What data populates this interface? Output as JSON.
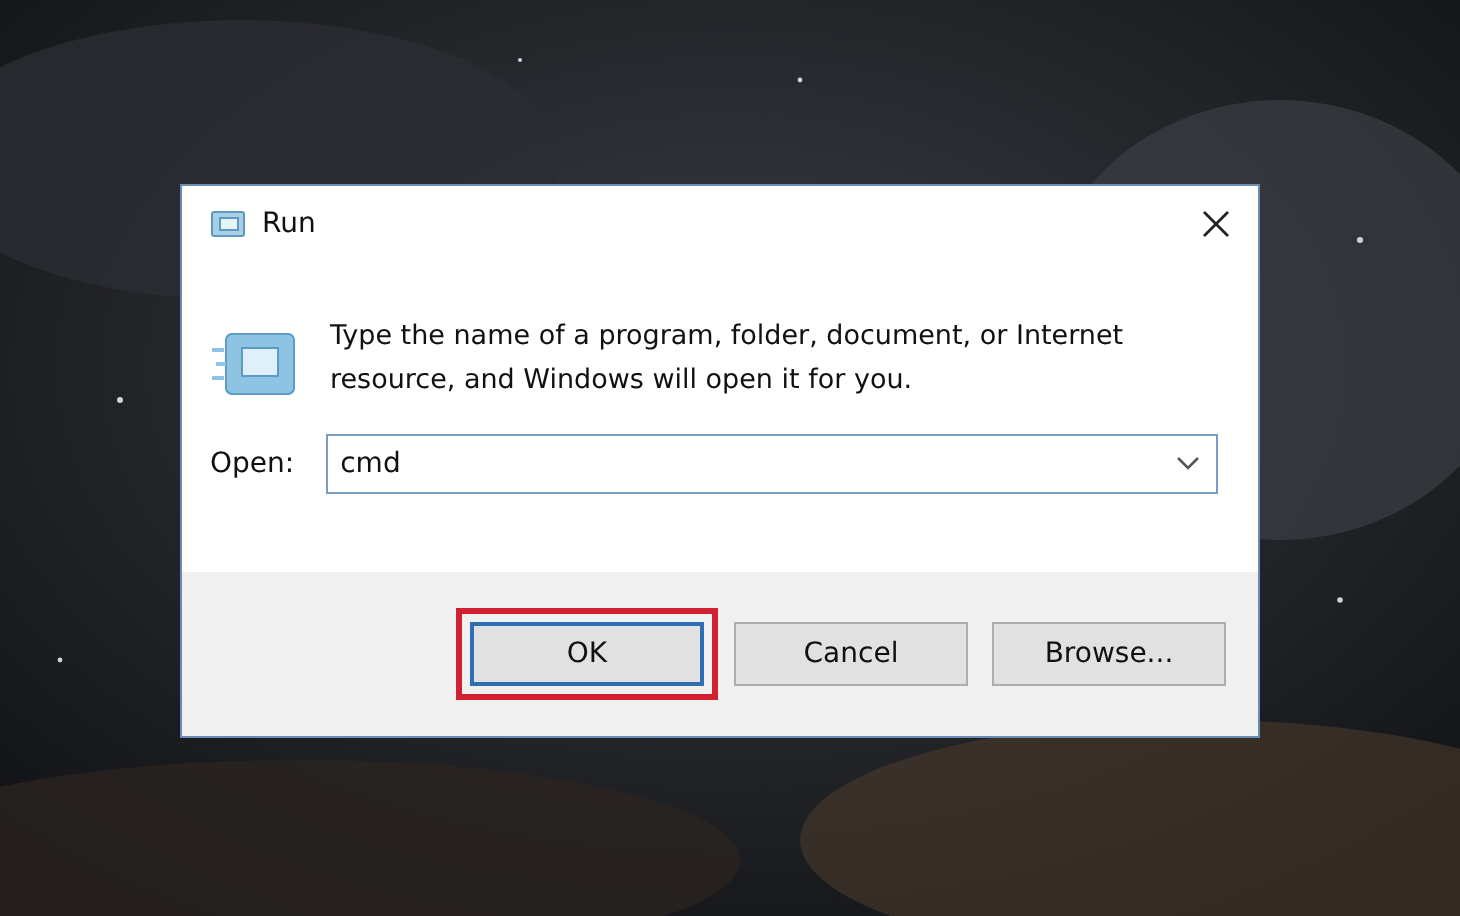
{
  "window": {
    "title": "Run",
    "message": "Type the name of a program, folder, document, or Internet resource, and Windows will open it for you."
  },
  "open_field": {
    "label": "Open:",
    "value": "cmd"
  },
  "buttons": [
    {
      "label": "OK",
      "default": true,
      "highlighted": true
    },
    {
      "label": "Cancel",
      "default": false,
      "highlighted": false
    },
    {
      "label": "Browse...",
      "default": false,
      "highlighted": false
    }
  ]
}
